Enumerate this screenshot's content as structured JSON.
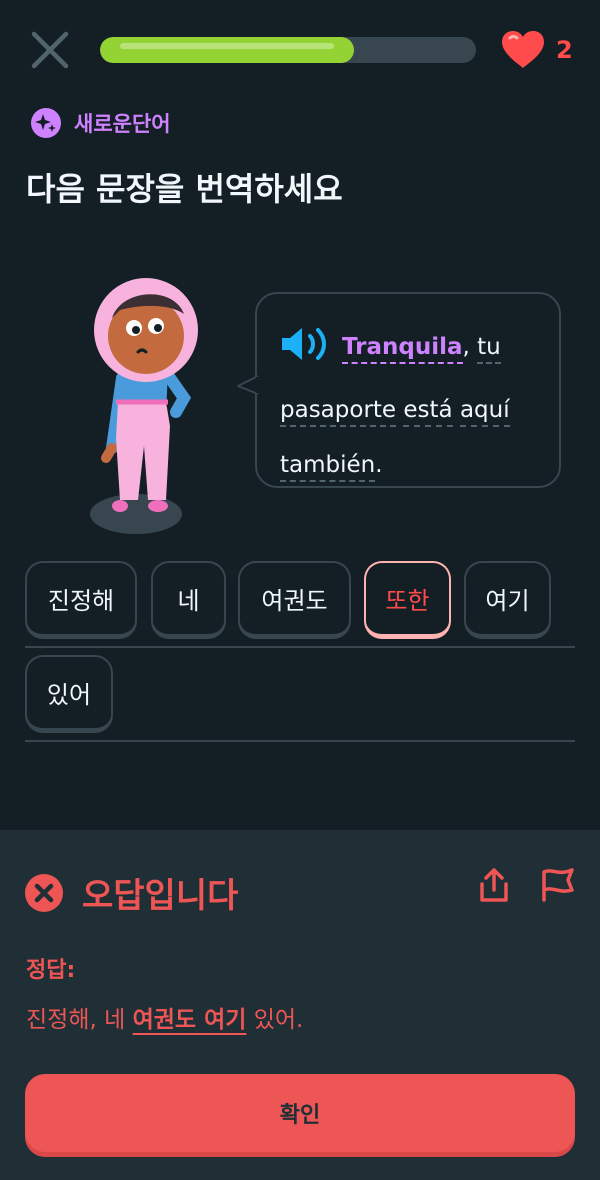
{
  "progress": {
    "fraction": 0.675
  },
  "hearts": {
    "count": "2",
    "icon": "heart-icon"
  },
  "badge": {
    "label": "새로운단어",
    "icon": "sparkle-icon"
  },
  "title": "다음 문장을 번역하세요",
  "prompt": {
    "words": [
      {
        "text": "Tranquila",
        "highlight": true
      },
      {
        "text": ",",
        "punct": true
      },
      {
        "text": "tu"
      },
      {
        "text": "pasaporte"
      },
      {
        "text": "está"
      },
      {
        "text": "aquí"
      },
      {
        "text": "también"
      },
      {
        "text": ".",
        "punct": true
      }
    ]
  },
  "answer_tiles": [
    [
      {
        "label": "진정해"
      },
      {
        "label": "네"
      },
      {
        "label": "여권도"
      },
      {
        "label": "또한",
        "wrong": true
      },
      {
        "label": "여기"
      }
    ],
    [
      {
        "label": "있어"
      }
    ]
  ],
  "result": {
    "title": "오답입니다",
    "answer_label": "정답:",
    "answer_prefix": "진정해, 네 ",
    "answer_bold": "여권도 여기",
    "answer_suffix": " 있어."
  },
  "confirm_label": "확인",
  "colors": {
    "background": "#131f24",
    "sheet": "#202f36",
    "error": "#ee5555",
    "progress": "#93d333",
    "highlight": "#ce82ff",
    "speaker": "#1cb0f6"
  }
}
